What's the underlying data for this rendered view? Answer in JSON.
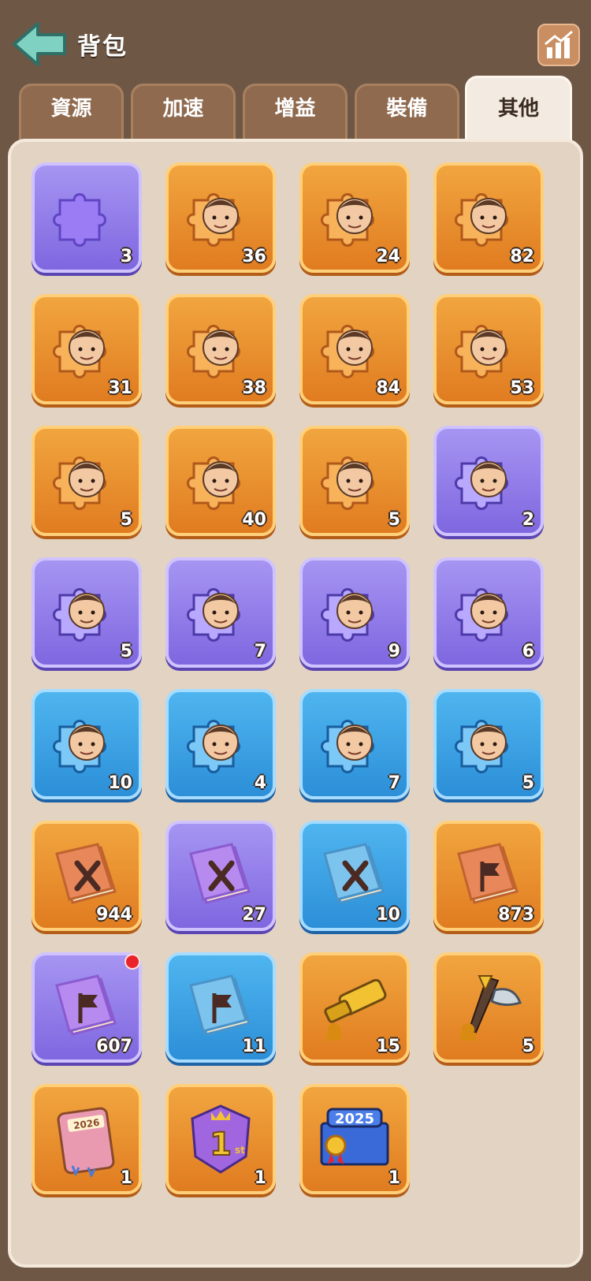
{
  "header": {
    "title": "背包",
    "back_icon": "back-arrow-icon",
    "stats_icon": "bar-chart-icon"
  },
  "tabs": [
    {
      "label": "資源",
      "active": false
    },
    {
      "label": "加速",
      "active": false
    },
    {
      "label": "增益",
      "active": false
    },
    {
      "label": "裝備",
      "active": false
    },
    {
      "label": "其他",
      "active": true
    }
  ],
  "items": [
    {
      "name": "puzzle-piece-purple",
      "color": "purple",
      "icon": "puzzle-icon",
      "qty": "3"
    },
    {
      "name": "hero-fragment-pirate-girl",
      "color": "orange",
      "icon": "hero-portrait-icon",
      "qty": "36"
    },
    {
      "name": "hero-fragment-red-hair-girl",
      "color": "orange",
      "icon": "hero-portrait-icon",
      "qty": "24"
    },
    {
      "name": "hero-fragment-black-hair-boy",
      "color": "orange",
      "icon": "hero-portrait-icon",
      "qty": "82"
    },
    {
      "name": "hero-fragment-spartan",
      "color": "orange",
      "icon": "hero-portrait-icon",
      "qty": "31"
    },
    {
      "name": "hero-fragment-old-man",
      "color": "orange",
      "icon": "hero-portrait-icon",
      "qty": "38"
    },
    {
      "name": "hero-fragment-dark-hair-man",
      "color": "orange",
      "icon": "hero-portrait-icon",
      "qty": "84"
    },
    {
      "name": "hero-fragment-nun",
      "color": "orange",
      "icon": "hero-portrait-icon",
      "qty": "53"
    },
    {
      "name": "hero-fragment-silver-hair-man",
      "color": "orange",
      "icon": "hero-portrait-icon",
      "qty": "5"
    },
    {
      "name": "hero-fragment-cap-boy",
      "color": "orange",
      "icon": "hero-portrait-icon",
      "qty": "40"
    },
    {
      "name": "hero-fragment-egyptian-girl",
      "color": "orange",
      "icon": "hero-portrait-icon",
      "qty": "5"
    },
    {
      "name": "hero-fragment-witch",
      "color": "purple",
      "icon": "hero-portrait-icon",
      "qty": "2"
    },
    {
      "name": "hero-fragment-crown-girl",
      "color": "purple",
      "icon": "hero-portrait-icon",
      "qty": "5"
    },
    {
      "name": "hero-fragment-brown-hair-man",
      "color": "purple",
      "icon": "hero-portrait-icon",
      "qty": "7"
    },
    {
      "name": "hero-fragment-bearded-hat",
      "color": "purple",
      "icon": "hero-portrait-icon",
      "qty": "9"
    },
    {
      "name": "hero-fragment-bearded-dark",
      "color": "purple",
      "icon": "hero-portrait-icon",
      "qty": "6"
    },
    {
      "name": "hero-fragment-hooded-archer",
      "color": "blue",
      "icon": "hero-portrait-icon",
      "qty": "10"
    },
    {
      "name": "hero-fragment-masked-warrior",
      "color": "blue",
      "icon": "hero-portrait-icon",
      "qty": "4"
    },
    {
      "name": "hero-fragment-goggles-elder",
      "color": "blue",
      "icon": "hero-portrait-icon",
      "qty": "7"
    },
    {
      "name": "hero-fragment-dwarf",
      "color": "blue",
      "icon": "hero-portrait-icon",
      "qty": "5"
    },
    {
      "name": "skill-book-sword-orange",
      "color": "orange",
      "icon": "book-sword-icon",
      "qty": "944"
    },
    {
      "name": "skill-book-sword-purple",
      "color": "purple",
      "icon": "book-sword-icon",
      "qty": "27"
    },
    {
      "name": "skill-book-sword-blue",
      "color": "blue",
      "icon": "book-sword-icon",
      "qty": "10"
    },
    {
      "name": "skill-book-flag-orange",
      "color": "orange",
      "icon": "book-flag-icon",
      "qty": "873"
    },
    {
      "name": "skill-book-flag-purple",
      "color": "purple",
      "icon": "book-flag-icon",
      "qty": "607",
      "new": true
    },
    {
      "name": "skill-book-flag-blue",
      "color": "blue",
      "icon": "book-flag-icon",
      "qty": "11"
    },
    {
      "name": "telescope-item",
      "color": "orange",
      "icon": "telescope-icon",
      "qty": "15"
    },
    {
      "name": "axe-item",
      "color": "orange",
      "icon": "axe-icon",
      "qty": "5"
    },
    {
      "name": "book-2026",
      "color": "orange",
      "icon": "book-2026-icon",
      "qty": "1"
    },
    {
      "name": "first-place-badge",
      "color": "orange",
      "icon": "first-badge-icon",
      "qty": "1"
    },
    {
      "name": "card-2025",
      "color": "orange",
      "icon": "card-2025-icon",
      "qty": "1"
    }
  ]
}
